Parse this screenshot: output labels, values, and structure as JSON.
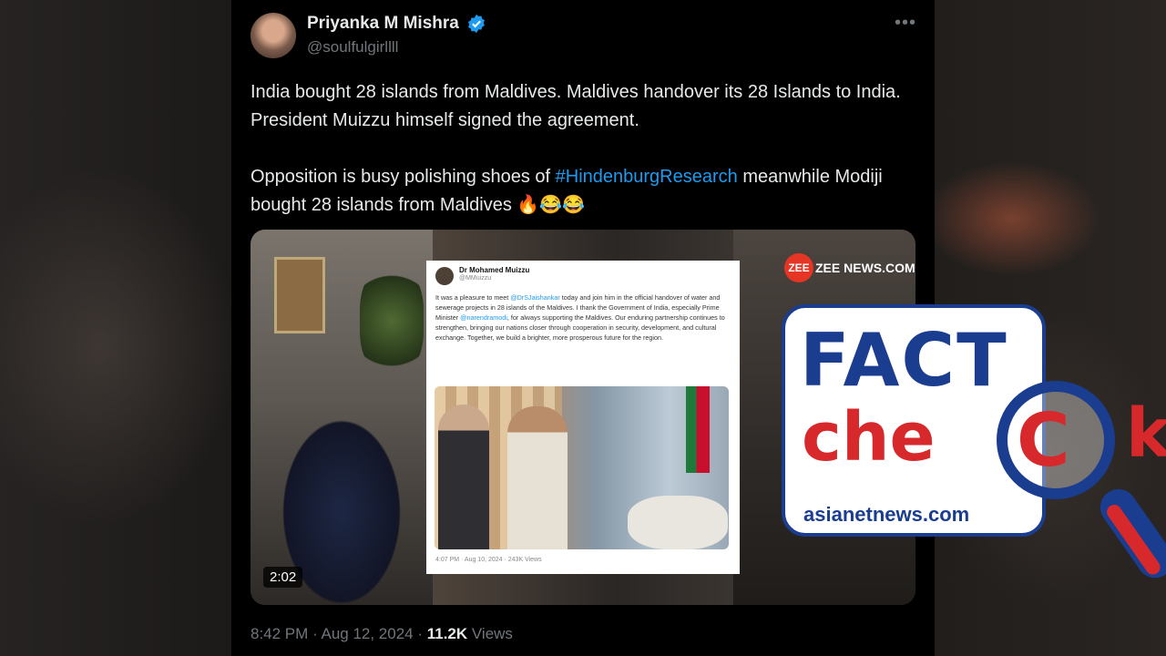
{
  "tweet": {
    "author_name": "Priyanka M Mishra",
    "handle": "@soulfulgirllll",
    "text_line1": "India bought 28 islands from Maldives. Maldives handover its 28 Islands to India. President Muizzu himself signed the agreement.",
    "text_line2_before": "Opposition is busy polishing shoes of ",
    "hashtag": "#HindenburgResearch",
    "text_line2_after": " meanwhile Modiji bought 28 islands from Maldives 🔥😂😂",
    "video_duration": "2:02",
    "timestamp": "8:42 PM · Aug 12, 2024 · ",
    "views_count": "11.2K",
    "views_label": " Views"
  },
  "video": {
    "watermark": "ZEE NEWS.COM",
    "zee_logo": "ZEE",
    "inner_tweet": {
      "name": "Dr Mohamed Muizzu",
      "handle": "@MMuizzu",
      "text_a": "It was a pleasure to meet ",
      "mention1": "@DrSJaishankar",
      "text_b": " today and join him in the official handover of water and sewerage projects in 28 islands of the Maldives. I thank the Government of India, especially Prime Minister ",
      "mention2": "@narendramodi",
      "text_c": ", for always supporting the Maldives. Our enduring partnership continues to strengthen, bringing our nations closer through cooperation in security, development, and cultural exchange. Together, we build a brighter, more prosperous future for the region.",
      "footer": "4:07 PM · Aug 10, 2024 · 243K Views"
    }
  },
  "factcheck": {
    "fact": "FACT",
    "check": "che",
    "check_k": "k",
    "lens_letter": "C",
    "brand": "asianetnews.com"
  },
  "colors": {
    "accent": "#1d9bf0",
    "fc_blue": "#1a3d8f",
    "fc_red": "#d7292b"
  }
}
